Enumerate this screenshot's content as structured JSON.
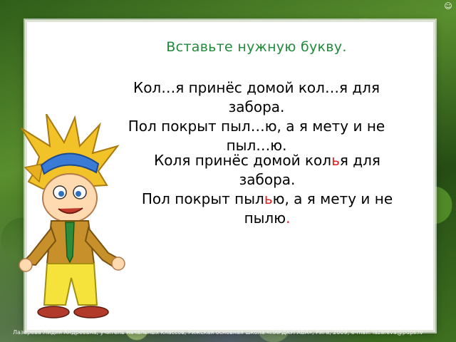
{
  "slide": {
    "title": "Вставьте нужную букву.",
    "task": {
      "line1": "Кол…я принёс домой кол…я для",
      "line2": "забора.",
      "line3": "Пол покрыт пыл…ю, а я мету и не",
      "line4": "пыл…ю."
    },
    "answer": {
      "line1_a": "Коля принёс домой кол",
      "line1_letter": "ь",
      "line1_b": "я для",
      "line2": "забора.",
      "line3_a": "Пол покрыт пыл",
      "line3_letter": "ь",
      "line3_b": "ю, а я мету и не",
      "line4_a": "пылю",
      "line4_dot": "."
    },
    "footer": "Лазарева Лидия Андреевна,  учитель начальных классов,  Рижская основная школа «ПАРДАУГАВА»,  Рига,  2009,  e-mail: lazareva@pdps.lv",
    "corner_icon": "corner-logo-icon"
  },
  "colors": {
    "title": "#1f8a3a",
    "highlight": "#e02020",
    "text": "#000000"
  }
}
